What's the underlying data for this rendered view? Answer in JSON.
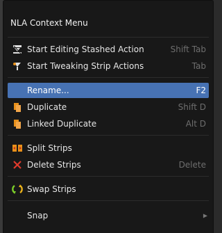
{
  "menu": {
    "title": "NLA Context Menu",
    "items": [
      {
        "label": "Start Editing Stashed Action",
        "shortcut": "Shift Tab",
        "icon": "edit-stashed-action-icon"
      },
      {
        "label": "Start Tweaking Strip Actions",
        "shortcut": "Tab",
        "icon": "tweak-strip-icon"
      },
      {
        "label": "Rename...",
        "shortcut": "F2",
        "icon": "",
        "highlighted": true
      },
      {
        "label": "Duplicate",
        "shortcut": "Shift D",
        "icon": "duplicate-icon"
      },
      {
        "label": "Linked Duplicate",
        "shortcut": "Alt D",
        "icon": "linked-duplicate-icon"
      },
      {
        "label": "Split Strips",
        "shortcut": "",
        "icon": "split-strips-icon"
      },
      {
        "label": "Delete Strips",
        "shortcut": "Delete",
        "icon": "delete-x-icon"
      },
      {
        "label": "Swap Strips",
        "shortcut": "",
        "icon": "swap-strips-icon"
      },
      {
        "label": "Snap",
        "shortcut": "",
        "icon": "",
        "submenu": true
      }
    ]
  },
  "colors": {
    "menu_bg": "#181818",
    "highlight": "#4772b3",
    "shortcut_text": "#6e6e6e",
    "orange_icon": "#e8901a",
    "red_x": "#e03a2c",
    "swap_green": "#7ccf2a"
  }
}
